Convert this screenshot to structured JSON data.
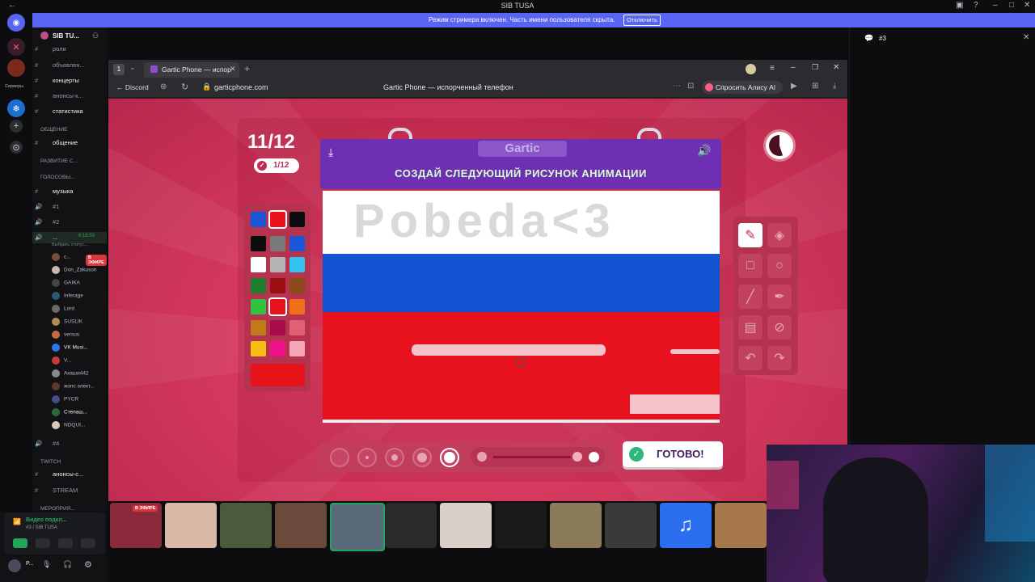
{
  "window": {
    "title": "SIB TUSA"
  },
  "streamer_bar": {
    "text": "Режим стримера включен. Часть имени пользователя скрыта.",
    "button": "Отключить"
  },
  "rail": {
    "label_servers": "Серверы"
  },
  "server": {
    "name": "SIB TU..."
  },
  "channels": [
    {
      "type": "text",
      "name": "роли"
    },
    {
      "type": "text",
      "name": "объявлен..."
    },
    {
      "type": "text",
      "name": "концерты"
    },
    {
      "type": "text",
      "name": "анонсы-к..."
    },
    {
      "type": "text",
      "name": "статистика"
    }
  ],
  "categories": {
    "obshenie": "ОБЩЕНИЕ",
    "razvitie": "РАЗВИТИЕ С...",
    "golosovye": "ГОЛОСОВЫ...",
    "twitch": "TWITCH",
    "meropriyatiya": "МЕРОПРИЯ..."
  },
  "channel_obshenie": "общение",
  "voice_channels": {
    "muzyka": "музыка",
    "c1": "#1",
    "c2": "#2",
    "c4": "#4"
  },
  "active_voice": {
    "name": "...",
    "timer": "6:16:59",
    "status": "Выбрать статус..."
  },
  "voice_users": [
    "c...",
    "Don_Zakuson",
    "GAIKA",
    "Inferage",
    "Lord",
    "SUSLIK",
    "versus",
    "VK Musi...",
    "V...",
    "Акаши442",
    "жопс элект...",
    "PYCR",
    "Степаш...",
    "NDQUI..."
  ],
  "live_badge": "В ЭФИРЕ",
  "twitch_channels": {
    "anonsy": "анонсы-с...",
    "stream": "STREAM"
  },
  "user_panel": {
    "video_label": "Видео подкл...",
    "sub": "#3 / SIB TUSA",
    "user": "P..."
  },
  "browser": {
    "tab_title": "Gartic Phone — испор",
    "back_label": "Discord",
    "url": "garticphone.com",
    "page_title": "Gartic Phone — испорченный телефон",
    "alice": "Спросить Алису AI"
  },
  "game": {
    "counter": "11/12",
    "badge": "1/12",
    "brand": "Gartic",
    "prompt": "СОЗДАЙ СЛЕДУЮЩИЙ РИСУНОК АНИМАЦИИ",
    "canvas_text": "Pobeda<3",
    "done_label": "ГОТОВО!"
  },
  "palette": {
    "selected": [
      "#1a56d6",
      "#e8141c",
      "#0d0d0d"
    ],
    "colors": [
      "#0d0d0d",
      "#7a7a7a",
      "#1a56d6",
      "#ffffff",
      "#b5b5b5",
      "#31c4ef",
      "#1e7d2f",
      "#9b0f14",
      "#8a4a1a",
      "#2fc440",
      "#e8141c",
      "#f0701a",
      "#c07a1a",
      "#a80c4a",
      "#e06075",
      "#f7bf12",
      "#f0108a",
      "#f4a8b6"
    ],
    "current": "#e8141c"
  },
  "right_panel": {
    "channel": "#3"
  },
  "strip_live": "В ЭФИРЕ"
}
